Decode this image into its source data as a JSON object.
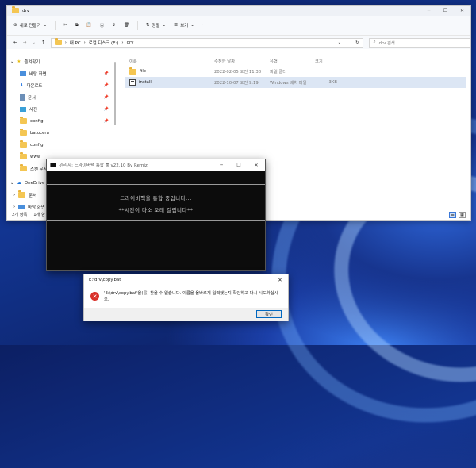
{
  "explorer": {
    "title": "drv",
    "toolbar": {
      "new_label": "새로 만들기",
      "sort_label": "정렬",
      "view_label": "보기",
      "more_label": "···"
    },
    "address": {
      "crumbs": [
        "내 PC",
        "로컬 디스크 (E:)",
        "drv"
      ],
      "search_placeholder": "drv 검색"
    },
    "nav": {
      "quick_access": "즐겨찾기",
      "items": [
        {
          "label": "바탕 화면",
          "icon": "desktop-icon",
          "pinned": true
        },
        {
          "label": "다운로드",
          "icon": "download-icon",
          "pinned": true
        },
        {
          "label": "문서",
          "icon": "document-icon",
          "pinned": true
        },
        {
          "label": "사진",
          "icon": "picture-icon",
          "pinned": true
        },
        {
          "label": "config",
          "icon": "folder-icon",
          "pinned": true
        },
        {
          "label": "batocera",
          "icon": "folder-icon",
          "pinned": false
        },
        {
          "label": "config",
          "icon": "folder-icon",
          "pinned": false
        },
        {
          "label": "www",
          "icon": "folder-icon",
          "pinned": false
        },
        {
          "label": "스캔 문서",
          "icon": "folder-icon",
          "pinned": false
        }
      ],
      "onedrive": "OneDrive",
      "od_items": [
        {
          "label": "문서"
        },
        {
          "label": "바탕 화면"
        }
      ]
    },
    "columns": {
      "name": "이름",
      "date": "수정한 날짜",
      "type": "유형",
      "size": "크기"
    },
    "files": [
      {
        "name": "file",
        "date": "2022-02-05 오전 11:38",
        "type": "파일 폴더",
        "size": ""
      },
      {
        "name": "install",
        "date": "2022-10-07 오전 9:19",
        "type": "Windows 배치 파일",
        "size": "3KB"
      }
    ],
    "status": {
      "count": "2개 항목",
      "selected": "1개 항"
    }
  },
  "console": {
    "title": "관리자:  드라이버팩 통합 툴 v22.10 By Remiz",
    "line1": "드라이버팩을 통합 중입니다...",
    "line2": "**시간이 다소 오래 걸립니다**"
  },
  "dialog": {
    "title": "E:\\drv\\copy.bat",
    "message": "'E:\\drv\\copy.bat'을(를) 찾을 수 없습니다. 이름을 올바르게 입력했는지 확인하고 다시 시도하십시오.",
    "ok_label": "확인",
    "close_glyph": "✕"
  }
}
